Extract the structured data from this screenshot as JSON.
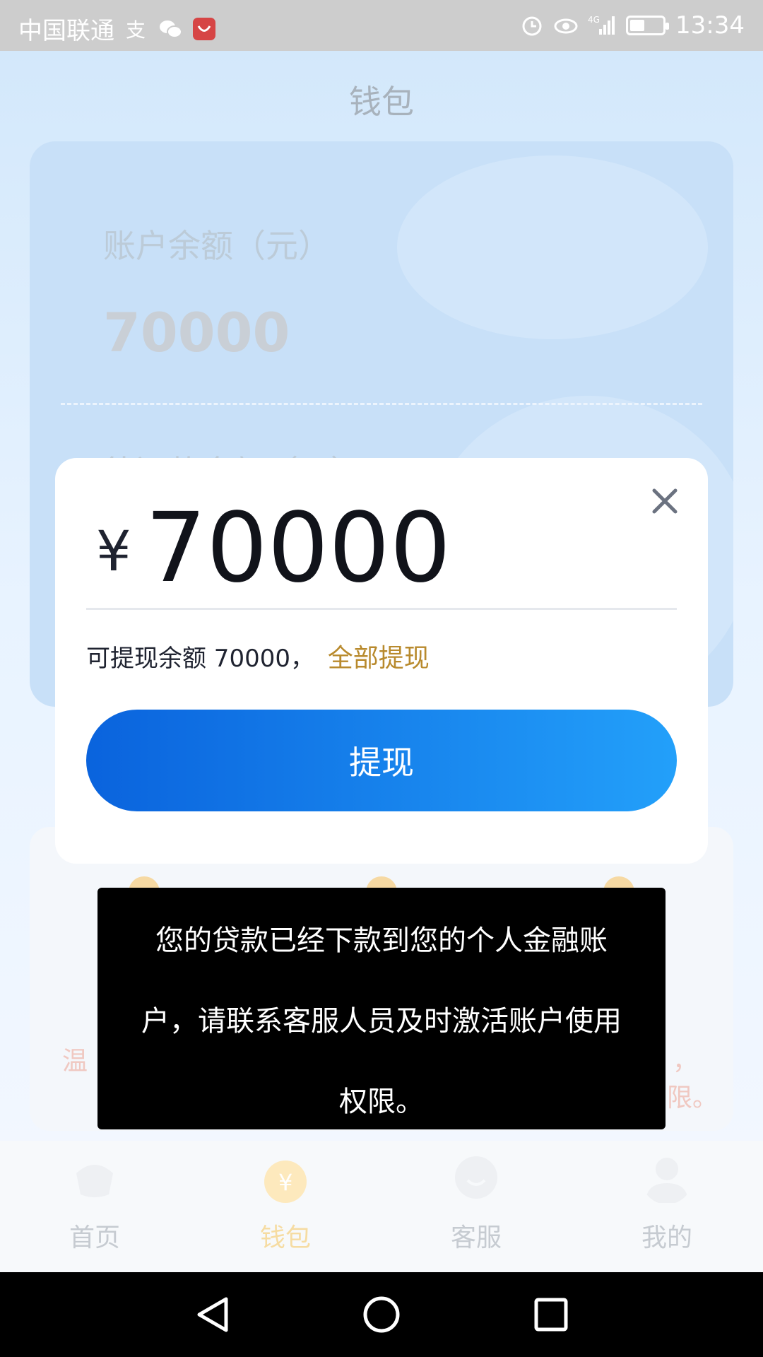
{
  "status_bar": {
    "carrier": "中国联通",
    "time": "13:34",
    "icons": [
      "alipay-icon",
      "wechat-icon",
      "huawei-store-icon",
      "alarm-icon",
      "eye-comfort-icon",
      "signal-4g-icon",
      "battery-icon"
    ],
    "battery_level": 0.45
  },
  "page": {
    "title": "钱包"
  },
  "balance_card": {
    "balance_label": "账户余额（元）",
    "balance_value": "70000",
    "repay_label": "待还款金额（元）"
  },
  "notice": {
    "left_text": "温",
    "right_text_1": "，",
    "right_text_2": "限。"
  },
  "tab_bar": {
    "tabs": [
      {
        "label": "首页",
        "icon": "home-icon",
        "active": false
      },
      {
        "label": "钱包",
        "icon": "wallet-icon",
        "active": true
      },
      {
        "label": "客服",
        "icon": "customer-service-icon",
        "active": false
      },
      {
        "label": "我的",
        "icon": "user-icon",
        "active": false
      }
    ]
  },
  "withdraw_modal": {
    "currency_symbol": "¥",
    "amount": "70000",
    "available_text": "可提现余额 70000，",
    "withdraw_all_label": "全部提现",
    "withdraw_button_label": "提现",
    "close_icon": "close-icon"
  },
  "toast": {
    "lines": [
      "您的贷款已经下款到您的个人金融账",
      "户，请联系客服人员及时激活账户使用",
      "权限。"
    ]
  },
  "nav_bar": {
    "buttons": [
      "back-icon",
      "home-circle-icon",
      "recent-apps-icon"
    ]
  },
  "colors": {
    "accent_gold": "#b88a2d",
    "button_blue_start": "#0a63dd",
    "button_blue_end": "#23a0fa"
  }
}
